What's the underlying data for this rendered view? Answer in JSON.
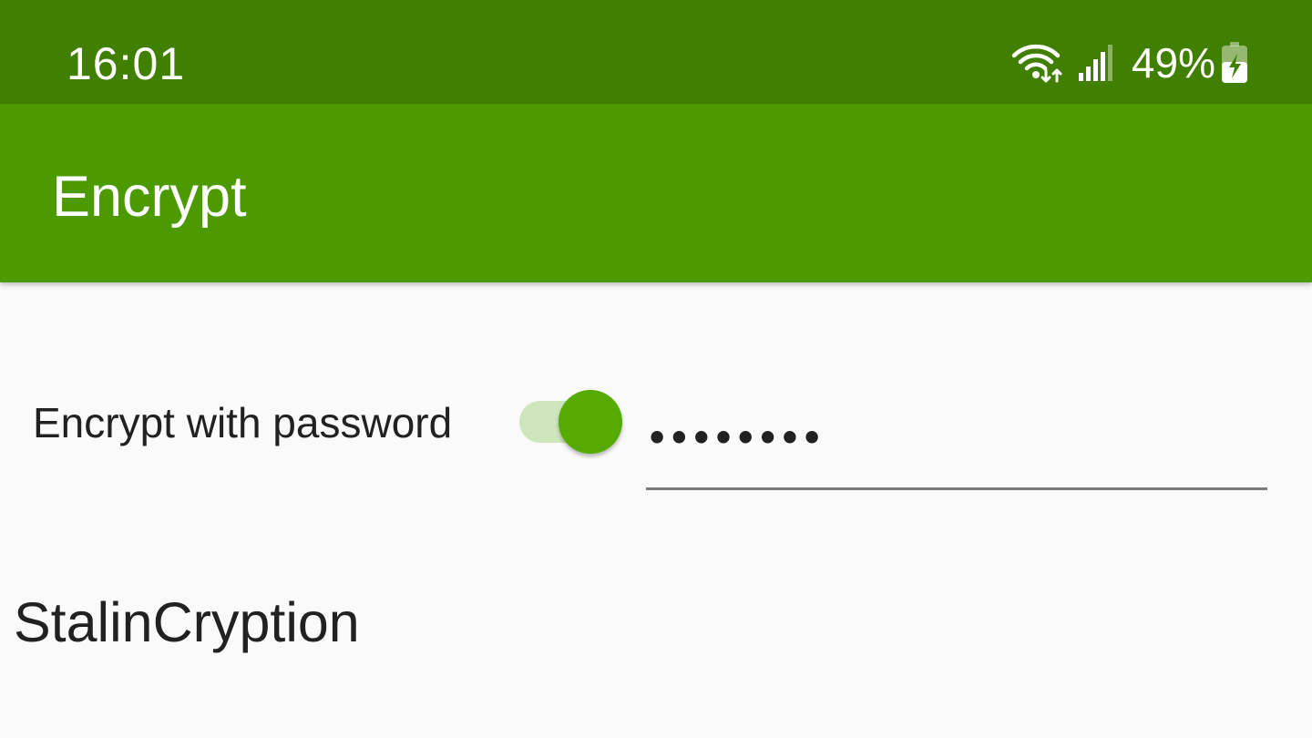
{
  "status_bar": {
    "time": "16:01",
    "battery_percent": "49%",
    "icons": [
      "wifi-icon",
      "cellular-signal-icon",
      "battery-charging-icon"
    ],
    "background_color": "#417f00"
  },
  "app_bar": {
    "title": "Encrypt",
    "background_color": "#4c9a00"
  },
  "encryption": {
    "switch_label": "Encrypt with password",
    "switch_on": true,
    "switch_thumb_color": "#55ab00",
    "switch_track_color": "#cfe6bd",
    "password_masked": "••••••••"
  },
  "method": {
    "label": "StalinCryption"
  }
}
